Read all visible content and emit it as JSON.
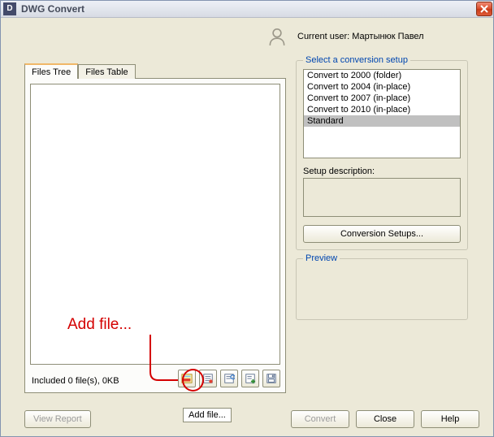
{
  "window": {
    "title": "DWG Convert",
    "app_icon_glyph": "D"
  },
  "user": {
    "label": "Current user: Мартынюк Павел"
  },
  "tabs": {
    "tree": "Files Tree",
    "table": "Files Table",
    "active": "tree"
  },
  "files": {
    "status": "Included 0 file(s), 0KB"
  },
  "annotation": {
    "text": "Add file..."
  },
  "toolbar": {
    "add_file_tooltip": "Add file..."
  },
  "setup": {
    "legend": "Select a conversion setup",
    "items": [
      "Convert to 2000 (folder)",
      "Convert to 2004 (in-place)",
      "Convert to 2007 (in-place)",
      "Convert to 2010 (in-place)",
      "Standard"
    ],
    "selected_index": 4,
    "desc_label": "Setup description:",
    "desc_value": "",
    "conv_setups_label": "Conversion Setups..."
  },
  "preview": {
    "legend": "Preview"
  },
  "buttons": {
    "view_report": "View Report",
    "convert": "Convert",
    "close": "Close",
    "help": "Help"
  }
}
